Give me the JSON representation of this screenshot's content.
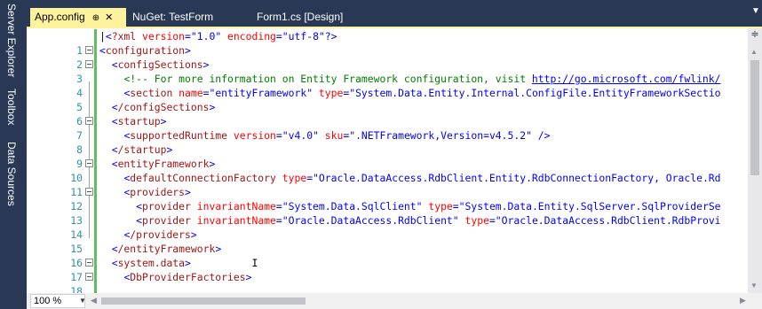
{
  "side_tabs": [
    "Server Explorer",
    "Toolbox",
    "Data Sources"
  ],
  "tabs": [
    {
      "label": "App.config",
      "pin": "⊕",
      "close": "✕"
    },
    {
      "label": "NuGet: TestForm"
    },
    {
      "label": "Form1.cs [Design]"
    }
  ],
  "tab_menu_icon": "dropdown-arrow-icon",
  "lines": [
    {
      "n": "1"
    },
    {
      "n": "2"
    },
    {
      "n": "3"
    },
    {
      "n": "4"
    },
    {
      "n": "5"
    },
    {
      "n": "6"
    },
    {
      "n": "7"
    },
    {
      "n": "8"
    },
    {
      "n": "9"
    },
    {
      "n": "10"
    },
    {
      "n": "11"
    },
    {
      "n": "12"
    },
    {
      "n": "13"
    },
    {
      "n": "14"
    },
    {
      "n": "15"
    },
    {
      "n": "16"
    },
    {
      "n": "17"
    },
    {
      "n": "18"
    }
  ],
  "code": {
    "l1_pi": "?xml",
    "l1_a1": " version",
    "l1_v1": "\"1.0\"",
    "l1_a2": " encoding",
    "l1_v2": "\"utf-8\"",
    "l1_end": "?>",
    "l2_tag": "configuration",
    "l3_tag": "configSections",
    "l4_comment": "<!-- For more information on Entity Framework configuration, visit ",
    "l4_link": "http://go.microsoft.com/fwlink/",
    "l5_tag": "section",
    "l5_a1": " name",
    "l5_v1": "\"entityFramework\"",
    "l5_a2": " type",
    "l5_v2": "\"System.Data.Entity.Internal.ConfigFile.EntityFrameworkSectio",
    "l6_tag": "/configSections",
    "l7_tag": "startup",
    "l8_tag": "supportedRuntime",
    "l8_a1": " version",
    "l8_v1": "\"v4.0\"",
    "l8_a2": " sku",
    "l8_v2": "\".NETFramework,Version=v4.5.2\"",
    "l8_end": " />",
    "l9_tag": "/startup",
    "l10_tag": "entityFramework",
    "l11_tag": "defaultConnectionFactory",
    "l11_a1": " type",
    "l11_v1": "\"Oracle.DataAccess.RdbClient.Entity.RdbConnectionFactory, Oracle.Rd",
    "l12_tag": "providers",
    "l13_tag": "provider",
    "l13_a1": " invariantName",
    "l13_v1": "\"System.Data.SqlClient\"",
    "l13_a2": " type",
    "l13_v2": "\"System.Data.Entity.SqlServer.SqlProviderSe",
    "l14_tag": "provider",
    "l14_a1": " invariantName",
    "l14_v1": "\"Oracle.DataAccess.RdbClient\"",
    "l14_a2": " type",
    "l14_v2": "\"Oracle.DataAccess.RdbClient.RdbProvi",
    "l15_tag": "/providers",
    "l16_tag": "/entityFramework",
    "l17_tag": "system.data",
    "l18_tag": "DbProviderFactories"
  },
  "zoom": "100 %",
  "colors": {
    "chrome": "#293955",
    "active_tab": "#fff29d",
    "line_number": "#2b91af",
    "xml_delim": "#0000ff",
    "xml_element": "#a31515",
    "xml_attribute": "#ff0000",
    "comment": "#008000",
    "change_bar": "#5fbf5f"
  }
}
